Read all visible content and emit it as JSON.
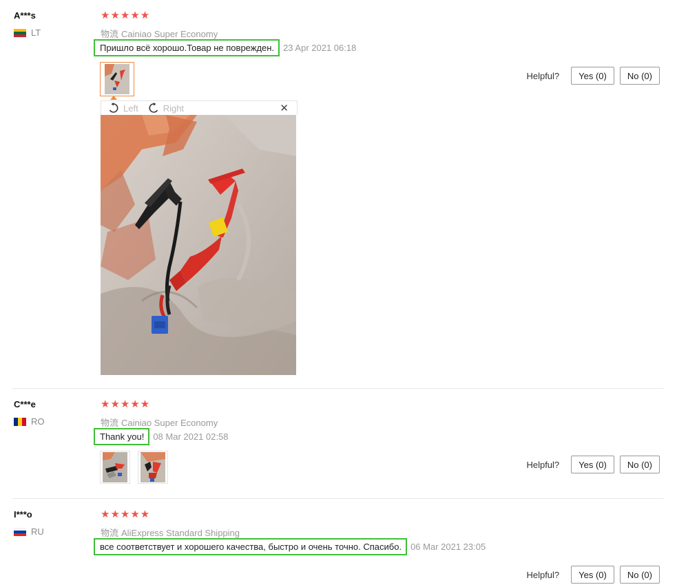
{
  "reviews": [
    {
      "username": "A***s",
      "country": "LT",
      "stars": "★★★★★",
      "logistics_label": "物流",
      "logistics": "Cainiao Super Economy",
      "comment": "Пришло всё хорошо.Товар не поврежден.",
      "date": "23 Apr 2021 06:18",
      "helpful_label": "Helpful?",
      "yes_label": "Yes (0)",
      "no_label": "No (0)",
      "viewer": {
        "left_label": "Left",
        "right_label": "Right",
        "close_glyph": "✕"
      }
    },
    {
      "username": "C***e",
      "country": "RO",
      "stars": "★★★★★",
      "logistics_label": "物流",
      "logistics": "Cainiao Super Economy",
      "comment": "Thank you!",
      "date": "08 Mar 2021 02:58",
      "helpful_label": "Helpful?",
      "yes_label": "Yes (0)",
      "no_label": "No (0)"
    },
    {
      "username": "I***o",
      "country": "RU",
      "stars": "★★★★★",
      "logistics_label": "物流",
      "logistics": "AliExpress Standard Shipping",
      "comment": "все соответствует и хорошего качества, быстро и очень точно. Спасибо.",
      "date": "06 Mar 2021 23:05",
      "helpful_label": "Helpful?",
      "yes_label": "Yes (0)",
      "no_label": "No (0)"
    }
  ],
  "colors": {
    "star": "#f0524a",
    "highlight_border": "#3fbf37",
    "active_thumb": "#f08a3c"
  }
}
